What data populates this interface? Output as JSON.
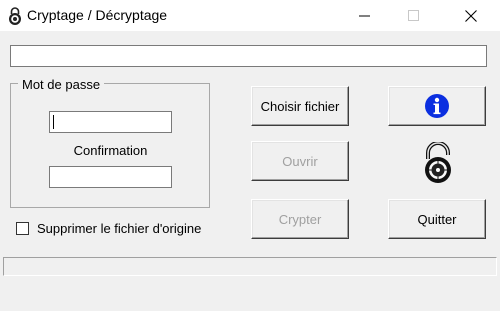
{
  "window": {
    "title": "Cryptage / Décryptage",
    "icon": "padlock-icon",
    "controls": [
      "minimize",
      "maximize",
      "close"
    ]
  },
  "file_path": {
    "value": ""
  },
  "password_group": {
    "label": "Mot  de passe",
    "password_value": "",
    "confirmation_label": "Confirmation",
    "confirmation_value": ""
  },
  "delete_original": {
    "label": "Supprimer le fichier d'origine",
    "checked": false
  },
  "buttons": {
    "choose_file": "Choisir fichier",
    "open": "Ouvrir",
    "crypt": "Crypter",
    "quit": "Quitter",
    "info_icon": "info-icon"
  },
  "status": {
    "text": ""
  },
  "colors": {
    "info_blue": "#0b2fe0",
    "disabled_text": "#a0a0a0"
  }
}
